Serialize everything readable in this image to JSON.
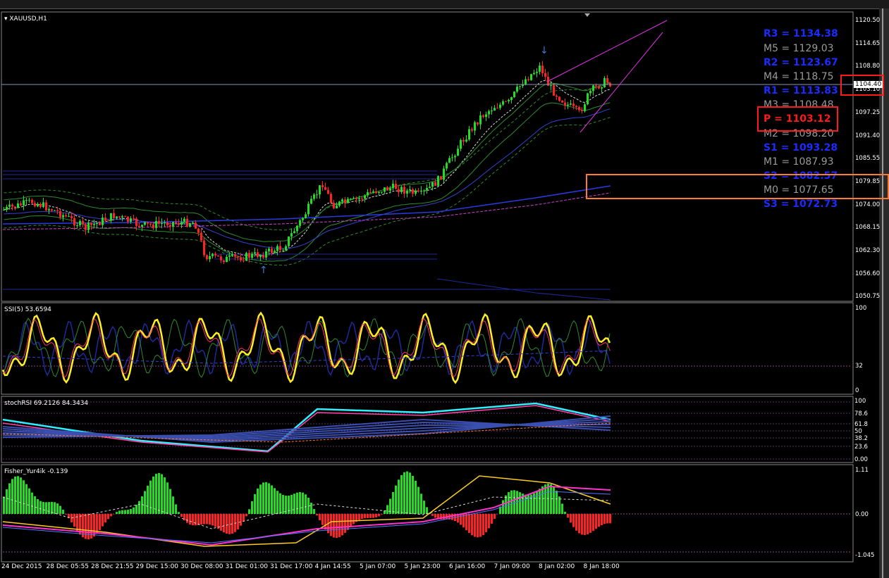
{
  "window": {
    "symbol_label": "XAUUSD,H1"
  },
  "price_axis": {
    "ticks": [
      "1120.50",
      "1114.65",
      "1108.80",
      "1103.10",
      "1097.25",
      "1091.40",
      "1085.55",
      "1079.85",
      "1074.00",
      "1068.15",
      "1062.30",
      "1056.60",
      "1050.75"
    ],
    "current_price": "1104.40"
  },
  "pivots": {
    "r3": "R3 = 1134.38",
    "m5": "M5 = 1129.03",
    "r2": "R2 = 1123.67",
    "m4": "M4 = 1118.75",
    "r1": "R1 = 1113.83",
    "m3": "M3 = 1108.48",
    "p": "P  = 1103.12",
    "m2": "M2 = 1098.20",
    "s1": "S1 = 1093.28",
    "m1": "M1 = 1087.93",
    "s2": "S2 = 1082.57",
    "m0": "M0 = 1077.65",
    "s3": "S3 = 1072.73"
  },
  "panels": {
    "rsi": {
      "label": "SSI(5) 53.6594",
      "ticks": [
        "100",
        "32",
        "0"
      ]
    },
    "stoch": {
      "label": "stochRSI 69.2126 84.3434",
      "ticks": [
        "100",
        "78.6",
        "61.8",
        "50",
        "38.2",
        "23.6",
        "0.00"
      ]
    },
    "fisher": {
      "label": "Fisher_Yur4ik -0.139",
      "ticks": [
        "1.11",
        "0.00",
        "-1.045"
      ]
    }
  },
  "time_axis": {
    "labels": [
      "24 Dec 2015",
      "28 Dec 05:55",
      "28 Dec 21:55",
      "29 Dec 15:00",
      "30 Dec 08:00",
      "31 Dec 01:00",
      "31 Dec 17:00",
      "4 Jan 14:55",
      "5 Jan 07:00",
      "5 Jan 23:00",
      "6 Jan 16:00",
      "7 Jan 09:00",
      "8 Jan 02:00",
      "8 Jan 18:00"
    ]
  },
  "colors": {
    "bull": "#22dd22",
    "bear": "#ff2222",
    "pivot_r": "#1a2cff",
    "pivot_m": "#9a9a9a",
    "pivot_p": "#ff1a1a",
    "highlight_red": "#ff1a1a",
    "highlight_orange": "#ff7a33"
  }
}
